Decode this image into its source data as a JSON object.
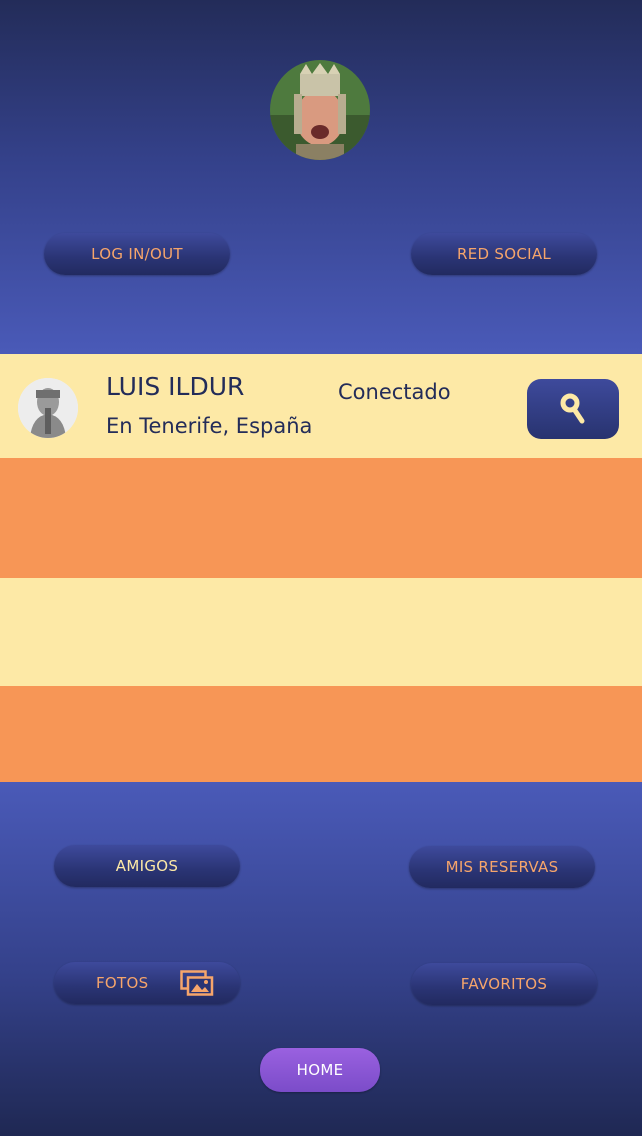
{
  "header": {
    "login_label": "LOG IN/OUT",
    "social_label": "RED SOCIAL"
  },
  "user": {
    "name": "LUIS ILDUR",
    "location": "En Tenerife, España",
    "status": "Conectado"
  },
  "menu": {
    "amigos": "AMIGOS",
    "reservas": "MIS RESERVAS",
    "fotos": "FOTOS",
    "favoritos": "FAVORITOS",
    "home": "HOME"
  },
  "colors": {
    "cream": "#fde9a6",
    "orange": "#f79656",
    "navy": "#232c59",
    "purple": "#8a56d6"
  },
  "icons": {
    "search": "search-icon",
    "photos": "photos-icon"
  }
}
